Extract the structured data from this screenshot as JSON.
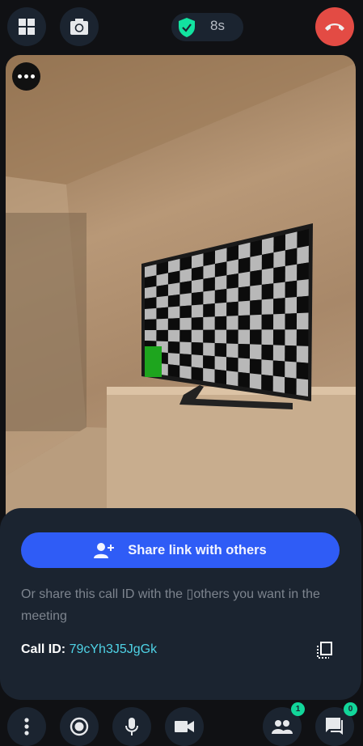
{
  "header": {
    "timer": "8s",
    "shield_color": "#12e3a0",
    "hangup_color": "#e34b44"
  },
  "panel": {
    "share_label": "Share link with others",
    "hint": "Or share this call ID with the ▯others you want in the meeting",
    "call_id_label": "Call ID:",
    "call_id": "79cYh3J5JgGk"
  },
  "toolbar": {
    "participants_count": "1",
    "chat_count": "0"
  }
}
